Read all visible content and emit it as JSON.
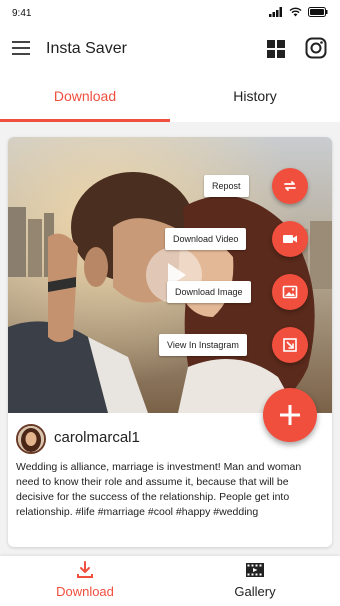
{
  "status_bar": {
    "time": "9:41"
  },
  "app_bar": {
    "title": "Insta Saver"
  },
  "tabs": [
    {
      "label": "Download",
      "active": true
    },
    {
      "label": "History",
      "active": false
    }
  ],
  "post": {
    "actions": [
      {
        "label": "Repost",
        "icon": "repost-icon"
      },
      {
        "label": "Download Video",
        "icon": "video-camera-icon"
      },
      {
        "label": "Download Image",
        "icon": "image-icon"
      },
      {
        "label": "View In Instagram",
        "icon": "open-external-icon"
      }
    ],
    "username": "carolmarcal1",
    "caption": "Wedding is alliance, marriage is investment! Man and woman need to know their role and assume it, because that will be decisive for the success of the relationship. People get into relationship. #life #marriage #cool #happy #wedding"
  },
  "bottom_nav": [
    {
      "label": "Download",
      "icon": "download-icon",
      "active": true
    },
    {
      "label": "Gallery",
      "icon": "film-icon",
      "active": false
    }
  ],
  "colors": {
    "accent": "#f04f3e",
    "background": "#f2f2f2"
  }
}
